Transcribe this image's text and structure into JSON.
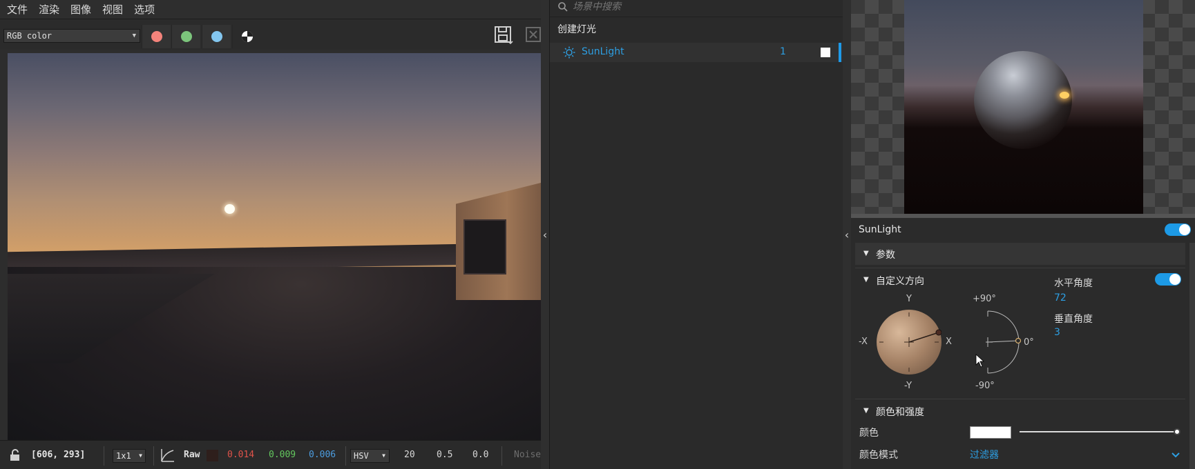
{
  "menu": {
    "items": [
      "文件",
      "渲染",
      "图像",
      "视图",
      "选项"
    ]
  },
  "toolbar": {
    "channel": "RGB color",
    "swatch_colors": {
      "red": "#f4837b",
      "green": "#7cc57c",
      "blue": "#83c6ef"
    }
  },
  "statusbar": {
    "coords": "[606, 293]",
    "zoom": "1x1",
    "raw_label": "Raw",
    "raw_color": "#2e1f1c",
    "r": "0.014",
    "g": "0.009",
    "b": "0.006",
    "mode": "HSV",
    "h": "20",
    "s": "0.5",
    "v": "0.0",
    "noise": "Noise",
    "colors": {
      "r": "#e0534a",
      "g": "#63c85e",
      "b": "#4c9de0"
    }
  },
  "scene": {
    "search_placeholder": "场景中搜索",
    "create_light": "创建灯光",
    "light_name": "SunLight",
    "light_count": "1"
  },
  "props": {
    "title": "SunLight",
    "params_label": "参数",
    "custom_dir_label": "自定义方向",
    "axes": {
      "y_pos": "Y",
      "y_neg": "-Y",
      "x_pos": "X",
      "x_neg": "-X",
      "plus90": "+90°",
      "zero": "0°",
      "minus90": "-90°"
    },
    "horizontal_label": "水平角度",
    "horizontal_value": "72",
    "vertical_label": "垂直角度",
    "vertical_value": "3",
    "color_intensity_label": "颜色和强度",
    "color_label": "颜色",
    "color_mode_label": "颜色模式",
    "color_mode_value": "过滤器",
    "accent": "#1d9ae6"
  }
}
